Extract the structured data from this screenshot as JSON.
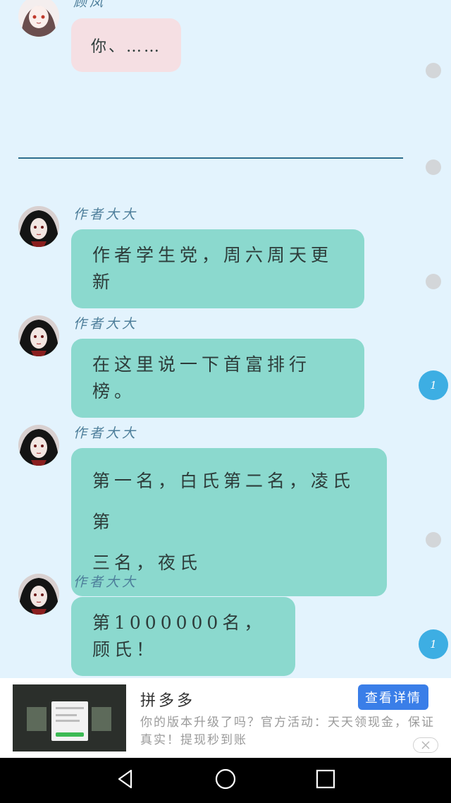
{
  "messages": [
    {
      "sender": "顾凤",
      "text": "你、……",
      "style": "pink"
    },
    {
      "sender": "作者大大",
      "text": "作者学生党，周六周天更新",
      "style": "teal"
    },
    {
      "sender": "作者大大",
      "text": "在这里说一下首富排行榜。",
      "style": "teal"
    },
    {
      "sender": "作者大大",
      "text_lines": [
        "第一名，白氏第二名，凌氏第",
        "三名，夜氏"
      ],
      "style": "teal"
    },
    {
      "sender": "作者大大",
      "text": "第1000000名，顾氏！",
      "style": "teal"
    }
  ],
  "side_counts": [
    "1",
    "1"
  ],
  "ad": {
    "title": "拼多多",
    "description": "你的版本升级了吗？官方活动：天天领现金，保证真实！提现秒到账",
    "button_label": "查看详情"
  },
  "colors": {
    "background": "#e3f3fd",
    "bubble_teal": "#8bd9ce",
    "bubble_pink": "#f5dfe3",
    "accent_blue": "#3daee3",
    "ad_button": "#3a7ee8"
  },
  "icons": [
    "back-icon",
    "home-icon",
    "recents-icon",
    "close-icon"
  ]
}
